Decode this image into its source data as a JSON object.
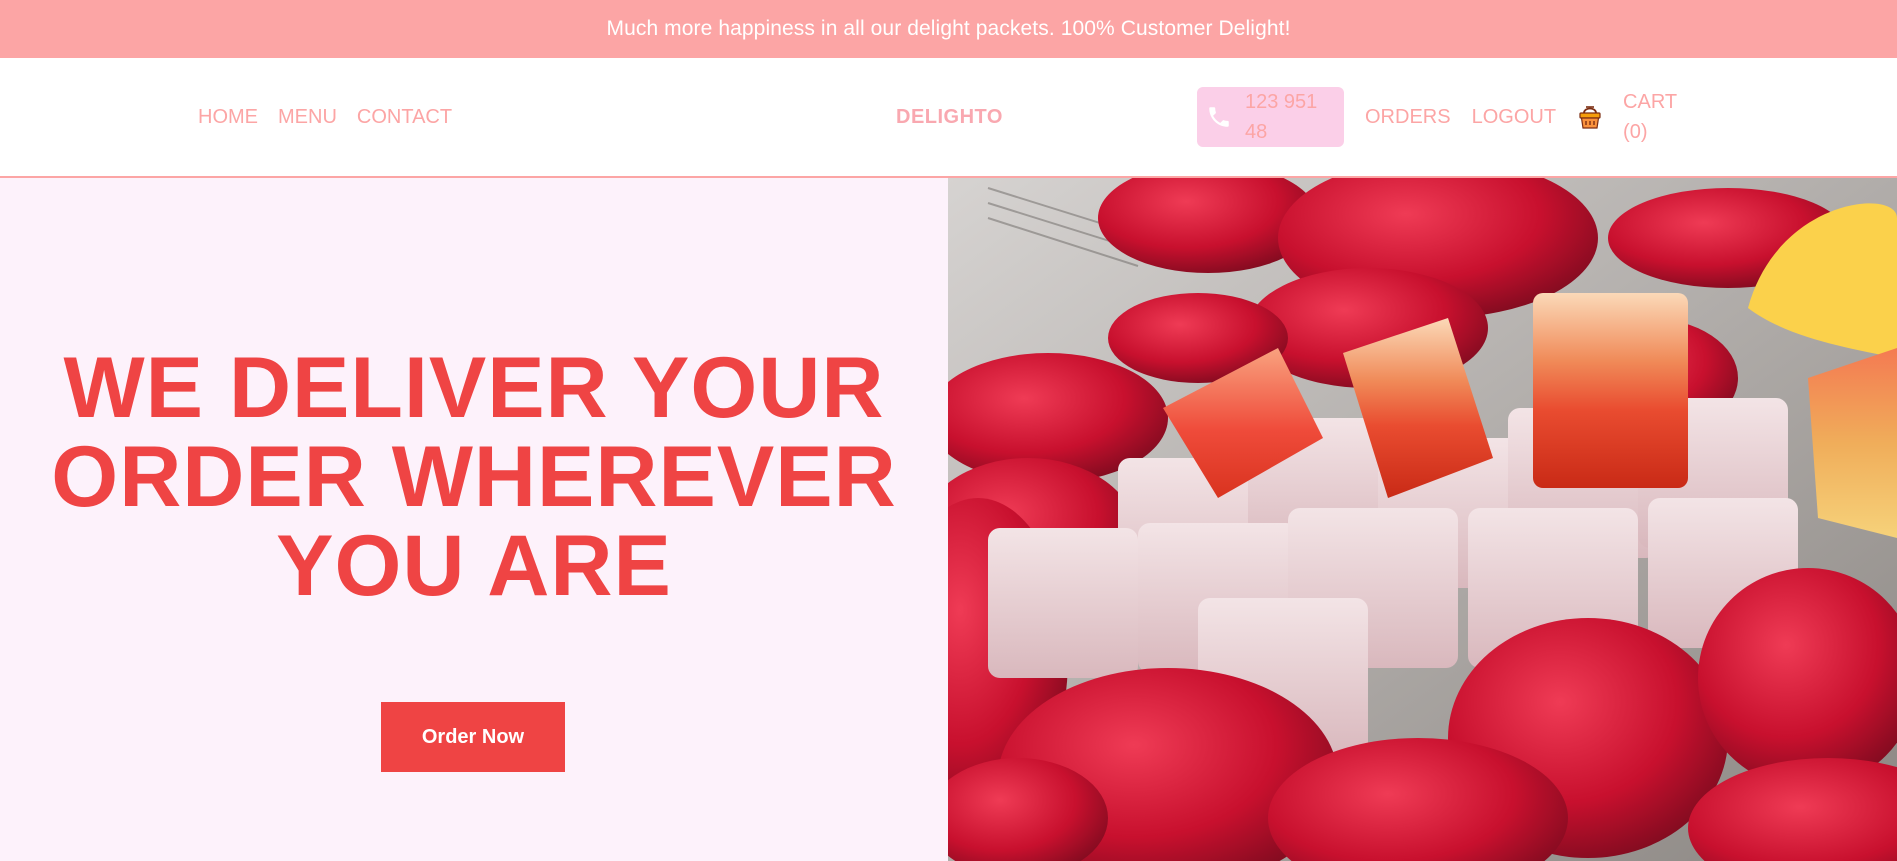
{
  "announcement": {
    "text": "Much more happiness in all our delight packets. 100% Customer Delight!"
  },
  "nav": {
    "left": [
      {
        "label": "HOME"
      },
      {
        "label": "MENU"
      },
      {
        "label": "CONTACT"
      }
    ],
    "brand": "DELIGHTO",
    "phone": {
      "number": "123 951 48",
      "icon": "phone-icon"
    },
    "orders_label": "ORDERS",
    "logout_label": "LOGOUT",
    "cart": {
      "label": "CART (0)",
      "icon": "basket-icon"
    }
  },
  "hero": {
    "title": "WE DELIVER YOUR ORDER WHEREVER YOU ARE",
    "cta_label": "Order Now",
    "image_subject": "turkish-delight-with-rose-petals"
  },
  "colors": {
    "announcement_bg": "#fca5a5",
    "accent": "#ef4444",
    "nav_text": "#fca5a5",
    "phone_pill_bg": "#fbcfe8",
    "hero_bg": "#fdf2fb"
  }
}
